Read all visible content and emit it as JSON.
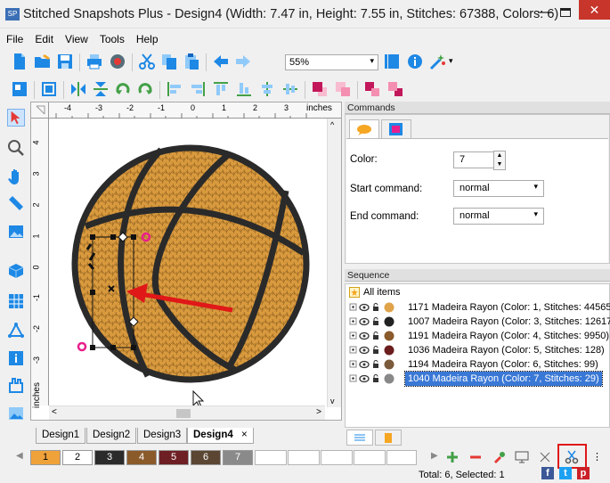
{
  "window": {
    "app_badge": "SP",
    "title": "Stitched Snapshots Plus - Design4 (Width: 7.47 in, Height: 7.55 in, Stitches: 67388, Colors: 6)",
    "min_symbol": "—",
    "close_symbol": "✕"
  },
  "menu": [
    "File",
    "Edit",
    "View",
    "Tools",
    "Help"
  ],
  "toolbar": {
    "zoom_value": "55%",
    "dropdown_arrow": "▾"
  },
  "ruler": {
    "h_ticks": [
      "-4",
      "-3",
      "-2",
      "-1",
      "0",
      "1",
      "2",
      "3"
    ],
    "h_unit": "inches",
    "v_ticks": [
      "4",
      "3",
      "2",
      "1",
      "0",
      "-1",
      "-2",
      "-3"
    ],
    "v_unit": "inches"
  },
  "doc_tabs": [
    "Design1",
    "Design2",
    "Design3",
    "Design4"
  ],
  "doc_tab_close": "×",
  "commands": {
    "title": "Commands",
    "color_label": "Color:",
    "color_value": "7",
    "start_label": "Start command:",
    "start_value": "normal",
    "end_label": "End command:",
    "end_value": "normal"
  },
  "sequence": {
    "title": "Sequence",
    "root": "All items",
    "items": [
      {
        "text": "1171 Madeira Rayon (Color: 1, Stitches: 44565)",
        "color": "#e0a34a"
      },
      {
        "text": "1007 Madeira Rayon (Color: 3, Stitches: 12617)",
        "color": "#222222"
      },
      {
        "text": "1191 Madeira Rayon (Color: 4, Stitches: 9950)",
        "color": "#8a5a2b"
      },
      {
        "text": "1036 Madeira Rayon (Color: 5, Stitches: 128)",
        "color": "#6b1d1d"
      },
      {
        "text": "1194 Madeira Rayon (Color: 6, Stitches: 99)",
        "color": "#7a5a3a"
      },
      {
        "text": "1040 Madeira Rayon (Color: 7, Stitches: 29)",
        "color": "#888888"
      }
    ],
    "selected_index": 5
  },
  "palette": [
    {
      "label": "1",
      "color": "#f0a23a"
    },
    {
      "label": "2",
      "color": "#ffffff"
    },
    {
      "label": "3",
      "color": "#2b2b2b"
    },
    {
      "label": "4",
      "color": "#8b5a2b"
    },
    {
      "label": "5",
      "color": "#6e1f24"
    },
    {
      "label": "6",
      "color": "#5a4632"
    },
    {
      "label": "7",
      "color": "#8a8a8a"
    }
  ],
  "status": {
    "text": "Total: 6, Selected: 1"
  },
  "social": [
    "f",
    "t",
    "p"
  ],
  "colors": {
    "accent_red": "#e01818",
    "selection_blue": "#3a78d6",
    "ball_orange": "#d99a3e",
    "ball_seam": "#2a2a2a"
  }
}
